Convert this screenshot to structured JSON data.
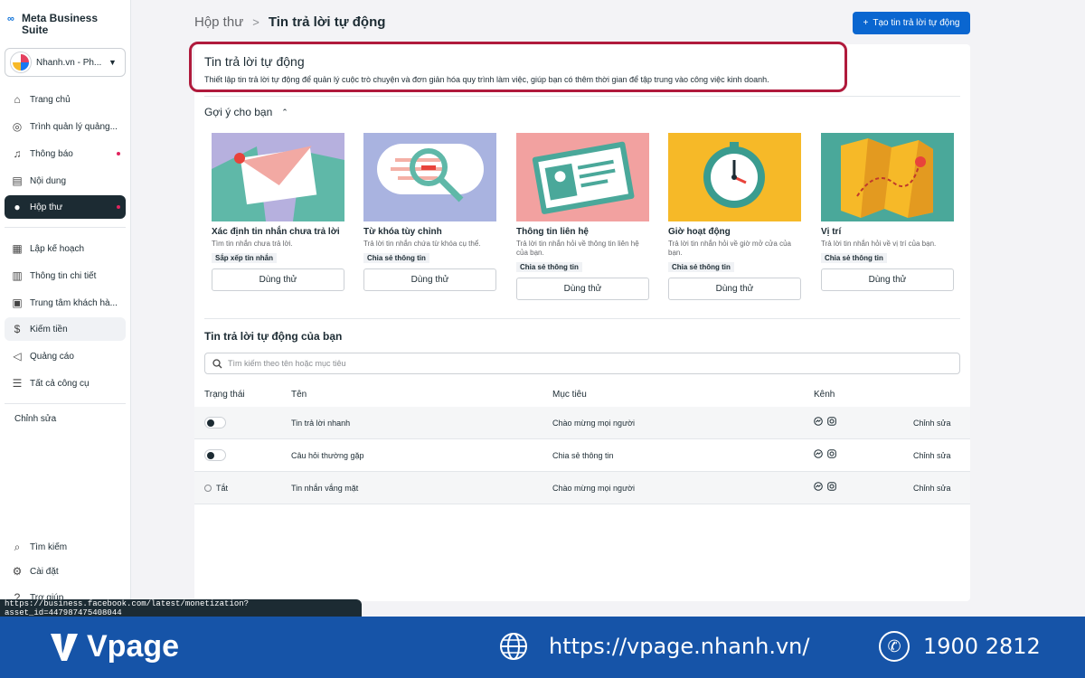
{
  "brand": {
    "logo_mark": "∞",
    "logo_text": "Meta Business Suite"
  },
  "account": {
    "name": "Nhanh.vn - Ph...",
    "caret": "▼"
  },
  "sidebar": {
    "items": [
      {
        "label": "Trang chủ",
        "icon": "home-icon",
        "glyph": "⌂"
      },
      {
        "label": "Trình quản lý quảng...",
        "icon": "compass-icon",
        "glyph": "◎"
      },
      {
        "label": "Thông báo",
        "icon": "bell-icon",
        "glyph": "♫"
      },
      {
        "label": "Nội dung",
        "icon": "content-icon",
        "glyph": "▤"
      },
      {
        "label": "Hộp thư",
        "icon": "chat-icon",
        "glyph": "●"
      },
      {
        "label": "Lập kế hoạch",
        "icon": "calendar-icon",
        "glyph": "▦"
      },
      {
        "label": "Thông tin chi tiết",
        "icon": "chart-icon",
        "glyph": "▥"
      },
      {
        "label": "Trung tâm khách hà...",
        "icon": "contacts-icon",
        "glyph": "▣"
      },
      {
        "label": "Kiếm tiền",
        "icon": "dollar-icon",
        "glyph": "$"
      },
      {
        "label": "Quảng cáo",
        "icon": "megaphone-icon",
        "glyph": "◁"
      },
      {
        "label": "Tất cả công cụ",
        "icon": "menu-icon",
        "glyph": "☰"
      }
    ],
    "edit_label": "Chỉnh sửa",
    "bottom_items": [
      {
        "label": "Tìm kiếm",
        "icon": "search-icon",
        "glyph": "⌕"
      },
      {
        "label": "Cài đặt",
        "icon": "gear-icon",
        "glyph": "⚙"
      },
      {
        "label": "Trợ giúp",
        "icon": "help-icon",
        "glyph": "?"
      }
    ]
  },
  "breadcrumb": {
    "parent": "Hộp thư",
    "separator": ">",
    "current": "Tin trả lời tự động"
  },
  "create_button": {
    "icon": "+",
    "label": "Tạo tin trả lời tự động"
  },
  "panel": {
    "title": "Tin trả lời tự động",
    "description": "Thiết lập tin trả lời tự động để quản lý cuộc trò chuyện và đơn giản hóa quy trình làm việc, giúp bạn có thêm thời gian để tập trung vào công việc kinh doanh."
  },
  "suggestions": {
    "heading": "Gợi ý cho bạn",
    "chevron": "⌃",
    "cards": [
      {
        "title": "Xác định tin nhắn chưa trả lời",
        "desc": "Tìm tin nhắn chưa trả lời.",
        "tag": "Sắp xếp tin nhắn",
        "button": "Dùng thử"
      },
      {
        "title": "Từ khóa tùy chỉnh",
        "desc": "Trả lời tin nhắn chứa từ khóa cụ thể.",
        "tag": "Chia sẻ thông tin",
        "button": "Dùng thử"
      },
      {
        "title": "Thông tin liên hệ",
        "desc": "Trả lời tin nhắn hỏi về thông tin liên hệ của bạn.",
        "tag": "Chia sẻ thông tin",
        "button": "Dùng thử"
      },
      {
        "title": "Giờ hoạt động",
        "desc": "Trả lời tin nhắn hỏi về giờ mở cửa của bạn.",
        "tag": "Chia sẻ thông tin",
        "button": "Dùng thử"
      },
      {
        "title": "Vị trí",
        "desc": "Trả lời tin nhắn hỏi về vị trí của bạn.",
        "tag": "Chia sẻ thông tin",
        "button": "Dùng thử"
      }
    ]
  },
  "your_replies": {
    "heading": "Tin trả lời tự động của bạn",
    "search_placeholder": "Tìm kiếm theo tên hoặc mục tiêu",
    "columns": [
      "Trạng thái",
      "Tên",
      "Mục tiêu",
      "Kênh"
    ],
    "rows": [
      {
        "status": "on",
        "status_label": "",
        "name": "Tin trả lời nhanh",
        "goal": "Chào mừng mọi người",
        "action": "Chỉnh sửa"
      },
      {
        "status": "on",
        "status_label": "",
        "name": "Câu hỏi thường gặp",
        "goal": "Chia sẻ thông tin",
        "action": "Chỉnh sửa"
      },
      {
        "status": "off",
        "status_label": "Tắt",
        "name": "Tin nhắn vắng mặt",
        "goal": "Chào mừng mọi người",
        "action": "Chỉnh sửa"
      }
    ]
  },
  "status_url": "https://business.facebook.com/latest/monetization?asset_id=447987475408044",
  "footer": {
    "brand": "Vpage",
    "website": "https://vpage.nhanh.vn/",
    "phone": "1900 2812",
    "phone_glyph": "✆"
  },
  "colors": {
    "accent": "#0a66d0",
    "highlight": "#b01a3c",
    "footer": "#1654a8",
    "sidebar_active": "#1c2b33"
  }
}
